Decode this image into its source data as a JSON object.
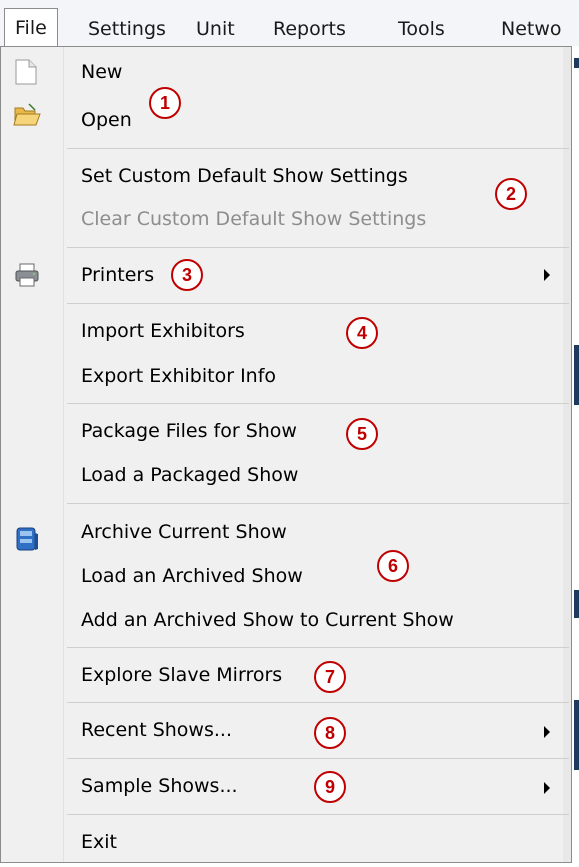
{
  "menubar": {
    "items": [
      "File",
      "Settings",
      "Unit",
      "Reports",
      "Tools",
      "Netwo"
    ]
  },
  "file_menu": {
    "new": "New",
    "open": "Open",
    "set_default": "Set Custom Default Show Settings",
    "clear_default": "Clear Custom Default Show Settings",
    "printers": "Printers",
    "import_exhibitors": "Import Exhibitors",
    "export_exhibitor_info": "Export Exhibitor Info",
    "package_files": "Package Files for Show",
    "load_packaged": "Load a Packaged Show",
    "archive_current": "Archive Current Show",
    "load_archived": "Load an Archived Show",
    "add_archived": "Add an Archived Show to Current Show",
    "explore_slave": "Explore Slave Mirrors",
    "recent_shows": "Recent Shows...",
    "sample_shows": "Sample Shows...",
    "exit": "Exit"
  },
  "callouts": [
    "1",
    "2",
    "3",
    "4",
    "5",
    "6",
    "7",
    "8",
    "9"
  ],
  "colors": {
    "callout": "#c00000",
    "disabled_text": "#8d8d8d",
    "menu_background": "#f0f0f0"
  }
}
